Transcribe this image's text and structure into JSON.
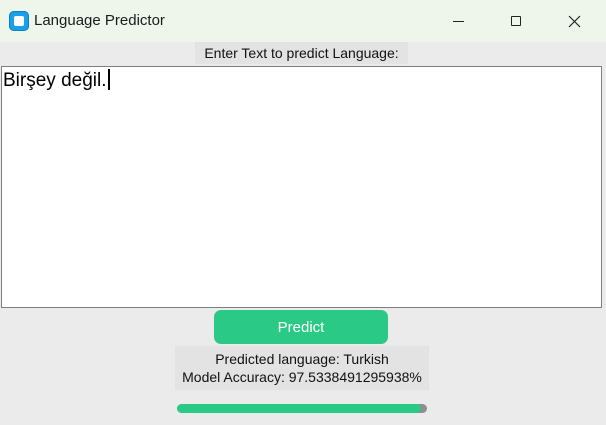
{
  "window": {
    "title": "Language Predictor",
    "controls": {
      "minimize_icon": "minimize-icon",
      "maximize_icon": "maximize-icon",
      "close_icon": "close-icon",
      "close_glyph": "✕"
    }
  },
  "input": {
    "label": "Enter Text to predict Language:",
    "value": "Birşey değil."
  },
  "predict_button": {
    "label": "Predict",
    "color": "#2bc986"
  },
  "results": {
    "predicted_language": "Predicted language: Turkish",
    "model_accuracy": "Model Accuracy: 97.5338491295938%"
  },
  "progress": {
    "fraction": 0.975,
    "fill_color": "#2bc986",
    "track_color": "#8e8e8e"
  }
}
